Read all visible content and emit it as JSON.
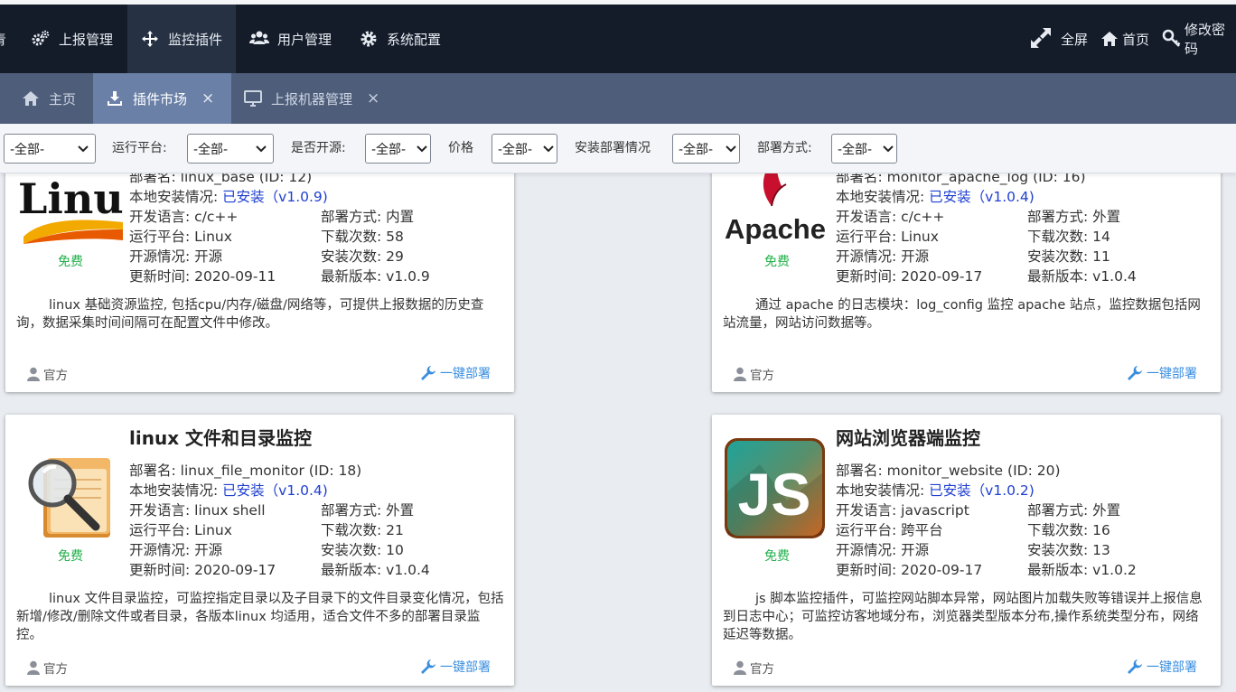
{
  "topnav": {
    "partial_left": "青",
    "items": [
      {
        "label": "上报管理",
        "icon": "gears-icon"
      },
      {
        "label": "监控插件",
        "icon": "arrows-move-icon",
        "active": true
      },
      {
        "label": "用户管理",
        "icon": "users-icon"
      },
      {
        "label": "系统配置",
        "icon": "gear-icon"
      }
    ],
    "right": [
      {
        "label": "全屏",
        "icon": "expand-icon"
      },
      {
        "label": "首页",
        "icon": "home-icon"
      },
      {
        "label": "修改密码",
        "icon": "key-icon"
      }
    ]
  },
  "tabs": [
    {
      "label": "主页",
      "icon": "home-icon"
    },
    {
      "label": "插件市场",
      "icon": "download-icon",
      "active": true,
      "close": "×"
    },
    {
      "label": "上报机器管理",
      "icon": "monitor-icon",
      "close": "×"
    }
  ],
  "filters": {
    "first_value": "-全部-",
    "items": [
      {
        "label": "运行平台:",
        "value": "-全部-"
      },
      {
        "label": "是否开源:",
        "value": "-全部-"
      },
      {
        "label": "价格",
        "value": "-全部-"
      },
      {
        "label": "安装部署情况",
        "value": "-全部-"
      },
      {
        "label": "部署方式:",
        "value": "-全部-"
      }
    ]
  },
  "cards": [
    {
      "title": "",
      "logo": "linux-logo",
      "free": "免费",
      "deploy_name": "部署名:  linux_base (ID: 12)",
      "install_label": "本地安装情况: ",
      "install_value": "已安装（v1.0.9)",
      "lang": "开发语言: c/c++",
      "deploy_mode": "部署方式: 内置",
      "platform": "运行平台: Linux",
      "downloads": "下载次数: 58",
      "opensource": "开源情况: 开源",
      "installs": "安装次数: 29",
      "updated": "更新时间: 2020-09-11",
      "latest": "最新版本: v1.0.9",
      "desc": "linux 基础资源监控, 包括cpu/内存/磁盘/网络等，可提供上报数据的历史查询，数据采集时间间隔可在配置文件中修改。",
      "author": "官方",
      "deploy_btn": "一键部署"
    },
    {
      "title": "",
      "logo": "apache-logo",
      "free": "免费",
      "deploy_name": "部署名:  monitor_apache_log (ID: 16)",
      "install_label": "本地安装情况: ",
      "install_value": "已安装（v1.0.4)",
      "lang": "开发语言: c/c++",
      "deploy_mode": "部署方式: 外置",
      "platform": "运行平台: Linux",
      "downloads": "下载次数: 14",
      "opensource": "开源情况: 开源",
      "installs": "安装次数: 11",
      "updated": "更新时间: 2020-09-17",
      "latest": "最新版本: v1.0.4",
      "desc": "通过 apache 的日志模块：log_config 监控 apache 站点，监控数据包括网站流量，网站访问数据等。",
      "author": "官方",
      "deploy_btn": "一键部署"
    },
    {
      "title": "linux 文件和目录监控",
      "logo": "folder-search-logo",
      "free": "免费",
      "deploy_name": "部署名:  linux_file_monitor (ID: 18)",
      "install_label": "本地安装情况: ",
      "install_value": "已安装（v1.0.4)",
      "lang": "开发语言: linux shell",
      "deploy_mode": "部署方式: 外置",
      "platform": "运行平台: Linux",
      "downloads": "下载次数: 21",
      "opensource": "开源情况: 开源",
      "installs": "安装次数: 10",
      "updated": "更新时间: 2020-09-17",
      "latest": "最新版本: v1.0.4",
      "desc": "linux 文件目录监控，可监控指定目录以及子目录下的文件目录变化情况，包括新增/修改/删除文件或者目录，各版本linux 均适用，适合文件不多的部署目录监控。",
      "author": "官方",
      "deploy_btn": "一键部署"
    },
    {
      "title": "网站浏览器端监控",
      "logo": "js-logo",
      "logo_text": "JS",
      "free": "免费",
      "deploy_name": "部署名:  monitor_website (ID: 20)",
      "install_label": "本地安装情况: ",
      "install_value": "已安装（v1.0.2)",
      "lang": "开发语言: javascript",
      "deploy_mode": "部署方式: 外置",
      "platform": "运行平台: 跨平台",
      "downloads": "下载次数: 16",
      "opensource": "开源情况: 开源",
      "installs": "安装次数: 13",
      "updated": "更新时间: 2020-09-17",
      "latest": "最新版本: v1.0.2",
      "desc": "js 脚本监控插件，可监控网站脚本异常，网站图片加载失败等错误并上报信息到日志中心；可监控访客地域分布，浏览器类型版本分布,操作系统类型分布，网络延迟等数据。",
      "author": "官方",
      "deploy_btn": "一键部署"
    }
  ],
  "colors": {
    "topnav_bg": "#141c2a",
    "tabbar_bg": "#4e5d7a",
    "tab_active_bg": "#6a80a7",
    "free_green": "#22b04a",
    "installed_blue": "#1f3fd1",
    "deploy_link": "#3a8ee0"
  }
}
